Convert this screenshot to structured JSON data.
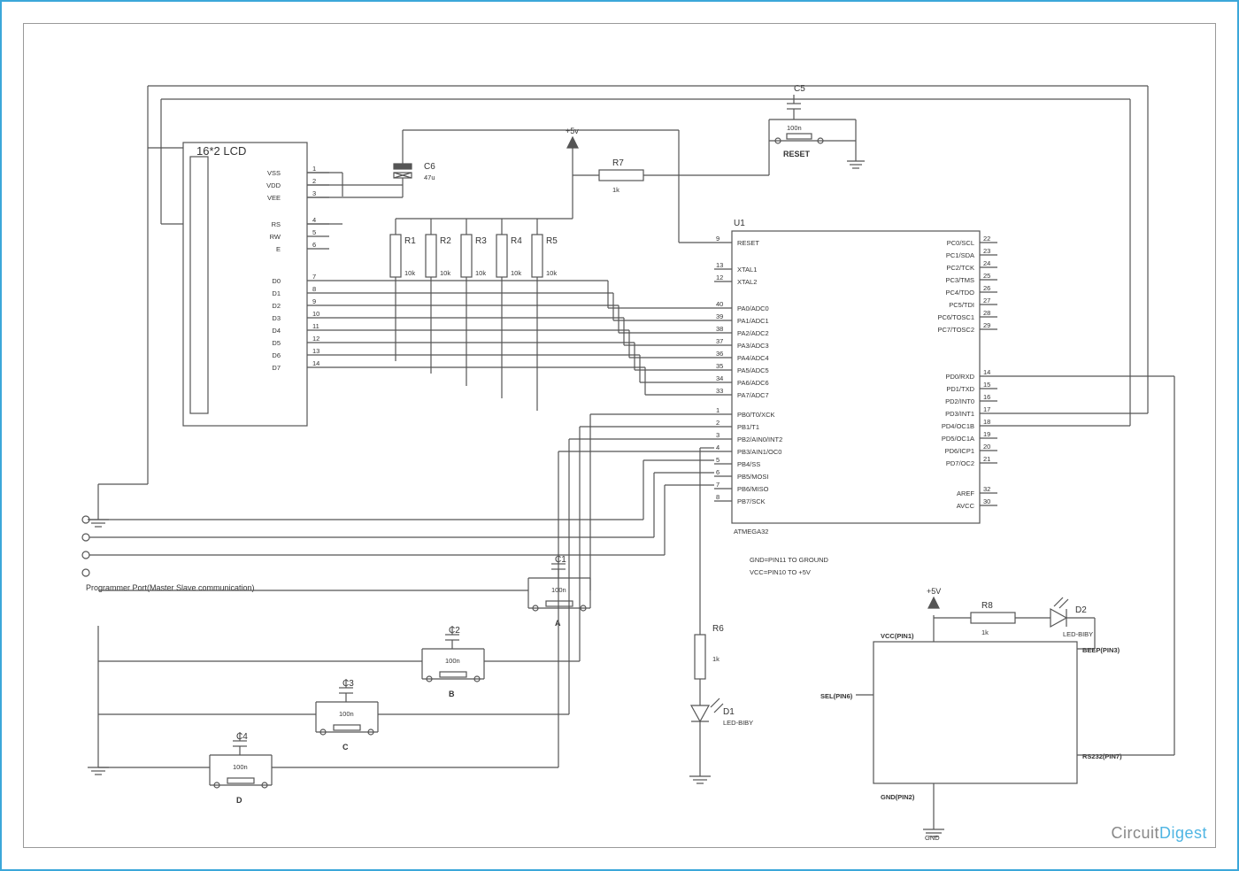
{
  "lcd": {
    "title": "16*2 LCD",
    "pins": [
      {
        "n": "1",
        "name": "VSS"
      },
      {
        "n": "2",
        "name": "VDD"
      },
      {
        "n": "3",
        "name": "VEE"
      },
      {
        "n": "4",
        "name": "RS"
      },
      {
        "n": "5",
        "name": "RW"
      },
      {
        "n": "6",
        "name": "E"
      },
      {
        "n": "7",
        "name": "D0"
      },
      {
        "n": "8",
        "name": "D1"
      },
      {
        "n": "9",
        "name": "D2"
      },
      {
        "n": "10",
        "name": "D3"
      },
      {
        "n": "11",
        "name": "D4"
      },
      {
        "n": "12",
        "name": "D5"
      },
      {
        "n": "13",
        "name": "D6"
      },
      {
        "n": "14",
        "name": "D7"
      }
    ]
  },
  "resistors": {
    "r1": {
      "label": "R1",
      "val": "10k"
    },
    "r2": {
      "label": "R2",
      "val": "10k"
    },
    "r3": {
      "label": "R3",
      "val": "10k"
    },
    "r4": {
      "label": "R4",
      "val": "10k"
    },
    "r5": {
      "label": "R5",
      "val": "10k"
    },
    "r6": {
      "label": "R6",
      "val": "1k"
    },
    "r7": {
      "label": "R7",
      "val": "1k"
    },
    "r8": {
      "label": "R8",
      "val": "1k"
    }
  },
  "caps": {
    "c1": {
      "label": "C1",
      "val": "100n"
    },
    "c2": {
      "label": "C2",
      "val": "100n"
    },
    "c3": {
      "label": "C3",
      "val": "100n"
    },
    "c4": {
      "label": "C4",
      "val": "100n"
    },
    "c5": {
      "label": "C5",
      "val": "100n"
    },
    "c6": {
      "label": "C6",
      "val": "47u"
    }
  },
  "leds": {
    "d1": {
      "label": "D1",
      "type": "LED-BIBY"
    },
    "d2": {
      "label": "D2",
      "type": "LED-BIBY"
    }
  },
  "buttons": {
    "a": "A",
    "b": "B",
    "c": "C",
    "d": "D",
    "reset": "RESET"
  },
  "mcu": {
    "ref": "U1",
    "part": "ATMEGA32",
    "left": [
      {
        "n": "9",
        "name": "RESET"
      },
      {
        "n": "13",
        "name": "XTAL1"
      },
      {
        "n": "12",
        "name": "XTAL2"
      },
      {
        "n": "40",
        "name": "PA0/ADC0"
      },
      {
        "n": "39",
        "name": "PA1/ADC1"
      },
      {
        "n": "38",
        "name": "PA2/ADC2"
      },
      {
        "n": "37",
        "name": "PA3/ADC3"
      },
      {
        "n": "36",
        "name": "PA4/ADC4"
      },
      {
        "n": "35",
        "name": "PA5/ADC5"
      },
      {
        "n": "34",
        "name": "PA6/ADC6"
      },
      {
        "n": "33",
        "name": "PA7/ADC7"
      },
      {
        "n": "1",
        "name": "PB0/T0/XCK"
      },
      {
        "n": "2",
        "name": "PB1/T1"
      },
      {
        "n": "3",
        "name": "PB2/AIN0/INT2"
      },
      {
        "n": "4",
        "name": "PB3/AIN1/OC0"
      },
      {
        "n": "5",
        "name": "PB4/SS"
      },
      {
        "n": "6",
        "name": "PB5/MOSI"
      },
      {
        "n": "7",
        "name": "PB6/MISO"
      },
      {
        "n": "8",
        "name": "PB7/SCK"
      }
    ],
    "right": [
      {
        "n": "22",
        "name": "PC0/SCL"
      },
      {
        "n": "23",
        "name": "PC1/SDA"
      },
      {
        "n": "24",
        "name": "PC2/TCK"
      },
      {
        "n": "25",
        "name": "PC3/TMS"
      },
      {
        "n": "26",
        "name": "PC4/TDO"
      },
      {
        "n": "27",
        "name": "PC5/TDI"
      },
      {
        "n": "28",
        "name": "PC6/TOSC1"
      },
      {
        "n": "29",
        "name": "PC7/TOSC2"
      },
      {
        "n": "14",
        "name": "PD0/RXD"
      },
      {
        "n": "15",
        "name": "PD1/TXD"
      },
      {
        "n": "16",
        "name": "PD2/INT0"
      },
      {
        "n": "17",
        "name": "PD3/INT1"
      },
      {
        "n": "18",
        "name": "PD4/OC1B"
      },
      {
        "n": "19",
        "name": "PD5/OC1A"
      },
      {
        "n": "20",
        "name": "PD6/ICP1"
      },
      {
        "n": "21",
        "name": "PD7/OC2"
      },
      {
        "n": "32",
        "name": "AREF"
      },
      {
        "n": "30",
        "name": "AVCC"
      }
    ]
  },
  "notes": {
    "gnd": "GND=PIN11  TO  GROUND",
    "vcc": "VCC=PIN10  TO  +5V",
    "prog": "Programmer Port(Master Slave communication)"
  },
  "rfid": {
    "vcc": "VCC(PIN1)",
    "gnd": "GND(PIN2)",
    "beep": "BEEP(PIN3)",
    "sel": "SEL(PIN6)",
    "rs": "RS232(PIN7)",
    "gndtxt": "GND"
  },
  "v5": "+5v",
  "v5b": "+5V",
  "logo": {
    "a": "Circuit",
    "b": "Digest"
  }
}
